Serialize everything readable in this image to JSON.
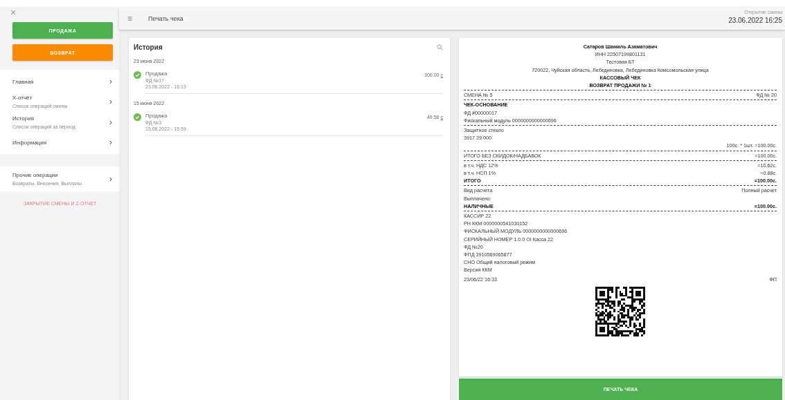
{
  "sidebar": {
    "close": "×",
    "buttons": [
      {
        "label": "ПРОДАЖА",
        "kind": "sale"
      },
      {
        "label": "ВОЗВРАТ",
        "kind": "return"
      }
    ],
    "items": [
      {
        "label": "Главная",
        "chevron": "›"
      },
      {
        "label": "X-отчёт",
        "sublabel": "Список операций смены",
        "chevron": "›"
      },
      {
        "label": "История",
        "sublabel": "Список операций за период",
        "chevron": "›"
      },
      {
        "label": "Информация",
        "chevron": "›"
      }
    ],
    "other_items": [
      {
        "label": "Прочие операции",
        "sublabel": "Возвраты, Внесения, Выплаты",
        "chevron": "›"
      }
    ],
    "close_shift": "ЗАКРЫТИЕ СМЕНЫ И Z-ОТЧЕТ"
  },
  "header": {
    "menu": "≡",
    "title": "Печать чека",
    "shift_label": "Открытие смены",
    "shift_time": "23.06.2022 16:25"
  },
  "history": {
    "title": "История",
    "groups": [
      {
        "date": "23 июня 2022",
        "items": [
          {
            "title": "Продажа",
            "doc": "ФД №17",
            "time": "23.06.2022 - 16:13",
            "amount": "300.00",
            "currency": "с"
          }
        ]
      },
      {
        "date": "15 июня 2022",
        "items": [
          {
            "title": "Продажа",
            "doc": "ФД №3",
            "time": "15.06.2022 - 15:59",
            "amount": "49.56",
            "currency": "с"
          }
        ]
      }
    ]
  },
  "receipt": {
    "sections": [
      {
        "lines": [
          {
            "kind": "center",
            "left": "Сатаров Шамиль Азаматович",
            "bold": true
          },
          {
            "kind": "center",
            "left": "ИНН 22507199801131",
            "bold": false
          },
          {
            "kind": "center",
            "left": "Тестовая БТ",
            "bold": false
          },
          {
            "kind": "center",
            "left": "720022, Чуйская область, Лебединовка, Лебединовка Комсомольская улица",
            "bold": false
          },
          {
            "kind": "center",
            "left": "КАССОВЫЙ ЧЕК",
            "bold": true
          },
          {
            "kind": "center",
            "left": "ВОЗВРАТ ПРОДАЖИ № 1",
            "bold": true
          }
        ]
      },
      {
        "lines": [
          {
            "kind": "row",
            "left": "СМЕНА № 5",
            "right": "ФД № 20",
            "bold": false
          }
        ]
      },
      {
        "lines": [
          {
            "kind": "row",
            "left": "ЧЕК-ОСНОВАНИЕ",
            "bold": true
          },
          {
            "kind": "row",
            "left": "ФД #00000017",
            "bold": false
          },
          {
            "kind": "row",
            "left": "Фискальный модуль 0000000000000696",
            "bold": false
          }
        ]
      },
      {
        "lines": [
          {
            "kind": "row",
            "left": "Защитное стекло",
            "bold": false
          },
          {
            "kind": "row",
            "left": "3917 29 000",
            "bold": false
          },
          {
            "kind": "row",
            "right": "100с. * 1шт. =100.00с.",
            "bold": false
          }
        ]
      },
      {
        "lines": [
          {
            "kind": "row",
            "left": "ИТОГО БЕЗ СКИДОК/НАДБАВОК",
            "right": "=100.00с.",
            "bold": false
          }
        ]
      },
      {
        "lines": [
          {
            "kind": "row",
            "left": "в т.ч. НДС 12%",
            "right": "=10.62с.",
            "bold": false
          },
          {
            "kind": "row",
            "left": "в т.ч. НСП 1%",
            "right": "=0.88с.",
            "bold": false
          },
          {
            "kind": "row",
            "left": "ИТОГО",
            "right": "=100.00с.",
            "bold": true
          }
        ]
      },
      {
        "lines": [
          {
            "kind": "row",
            "left": "Вид расчета",
            "right": "Полный расчет",
            "bold": false
          },
          {
            "kind": "row",
            "left": "Выплачено:",
            "bold": false
          },
          {
            "kind": "row",
            "left": "НАЛИЧНЫЕ",
            "right": "=100.00с.",
            "bold": true
          }
        ]
      },
      {
        "lines": [
          {
            "kind": "row",
            "left": "КАССИР 22",
            "bold": false
          },
          {
            "kind": "row",
            "left": "РН ККМ 0000000541030152",
            "bold": false
          },
          {
            "kind": "row",
            "left": "ФИСКАЛЬНЫЙ МОДУЛЬ 0000000000000696",
            "bold": false
          },
          {
            "kind": "row",
            "left": "СЕРИЙНЫЙ НОМЕР 1.0.0 О! Касса 22",
            "bold": false
          },
          {
            "kind": "row",
            "left": "ФД №20",
            "bold": false
          },
          {
            "kind": "row",
            "left": "ФПД 3910569065877",
            "bold": false
          },
          {
            "kind": "row",
            "left": "СНО Общий налоговый режим",
            "bold": false
          },
          {
            "kind": "row",
            "left": "Версия ККМ",
            "bold": false
          }
        ]
      },
      {
        "lines": [
          {
            "kind": "row",
            "left": "23/06/22 16:33",
            "right": "ФП",
            "bold": false
          }
        ]
      }
    ],
    "print_button": "ПЕЧАТЬ ЧЕКА"
  }
}
